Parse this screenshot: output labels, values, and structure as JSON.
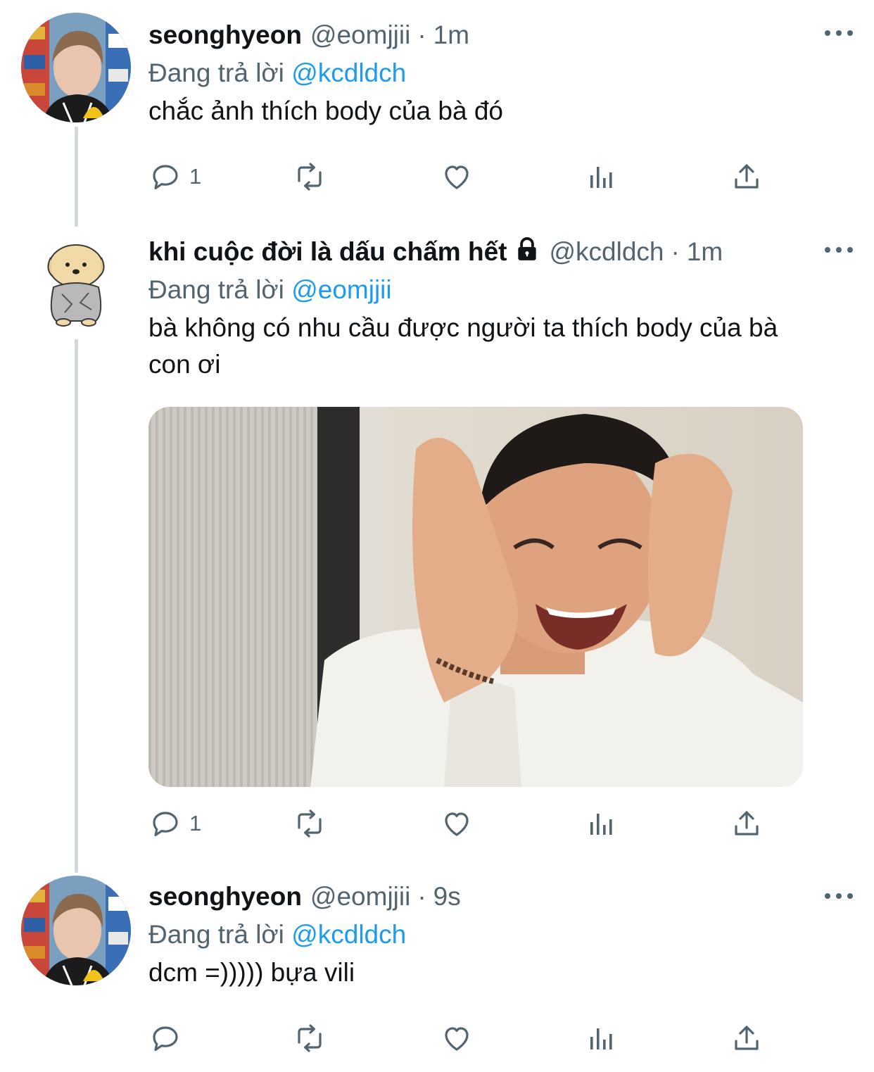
{
  "tweets": [
    {
      "name": "seonghyeon",
      "handle": "@eomjjii",
      "dot": "·",
      "time": "1m",
      "replying_prefix": "Đang trả lời",
      "replying_to": "@kcdldch",
      "text": "chắc ảnh thích body của bà đó",
      "reply_count": "1"
    },
    {
      "name": "khi cuộc đời là dấu chấm hết",
      "handle": "@kcdldch",
      "dot": "·",
      "time": "1m",
      "replying_prefix": "Đang trả lời",
      "replying_to": "@eomjjii",
      "text": "bà không có nhu cầu được người ta thích body của bà con ơi",
      "reply_count": "1"
    },
    {
      "name": "seonghyeon",
      "handle": "@eomjjii",
      "dot": "·",
      "time": "9s",
      "replying_prefix": "Đang trả lời",
      "replying_to": "@kcdldch",
      "text": "dcm =))))) bựa vili",
      "reply_count": ""
    }
  ],
  "icons": {
    "reply": "reply-icon",
    "retweet": "retweet-icon",
    "like": "heart-icon",
    "views": "views-icon",
    "share": "share-icon",
    "more": "more-icon",
    "lock": "lock-icon"
  },
  "colors": {
    "accent": "#1d9bf0",
    "secondary_text": "#536471",
    "thread_line": "#cfd9de"
  }
}
